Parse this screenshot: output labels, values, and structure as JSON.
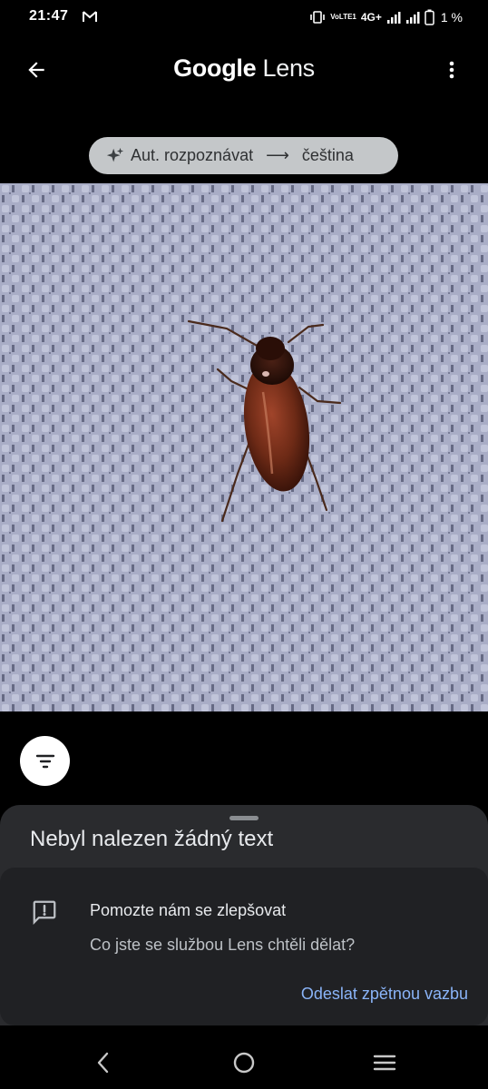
{
  "status_bar": {
    "time": "21:47",
    "notification_icon": "gmail-icon",
    "volte_label": "VoLTE1",
    "network_label": "4G+",
    "battery_percent": "1 %"
  },
  "app_bar": {
    "title_brand": "Google",
    "title_product": "Lens",
    "back_icon": "arrow-back-icon",
    "menu_icon": "more-vert-icon"
  },
  "language_chip": {
    "source_language": "Aut. rozpoznávat",
    "target_language": "čeština"
  },
  "photo": {
    "subject": "beetle-on-fabric-image",
    "colors": {
      "fabric": "#a9acc4",
      "fabric_dark": "#5c5f78",
      "beetle": "#6a2a16"
    }
  },
  "filter_button": {
    "icon": "filter-list-icon"
  },
  "sheet": {
    "title": "Nebyl nalezen žádný text",
    "feedback": {
      "icon": "feedback-icon",
      "heading": "Pomozte nám se zlepšovat",
      "question": "Co jste se službou Lens chtěli dělat?",
      "action_label": "Odeslat zpětnou vazbu"
    }
  },
  "nav_bar": {
    "back_icon": "nav-back-icon",
    "home_icon": "nav-home-icon",
    "recents_icon": "nav-recents-icon"
  },
  "colors": {
    "background": "#000000",
    "sheet": "#2a2b2e",
    "card": "#202124",
    "accent_link": "#8ab4f8",
    "chip": "#c4c7c9"
  }
}
